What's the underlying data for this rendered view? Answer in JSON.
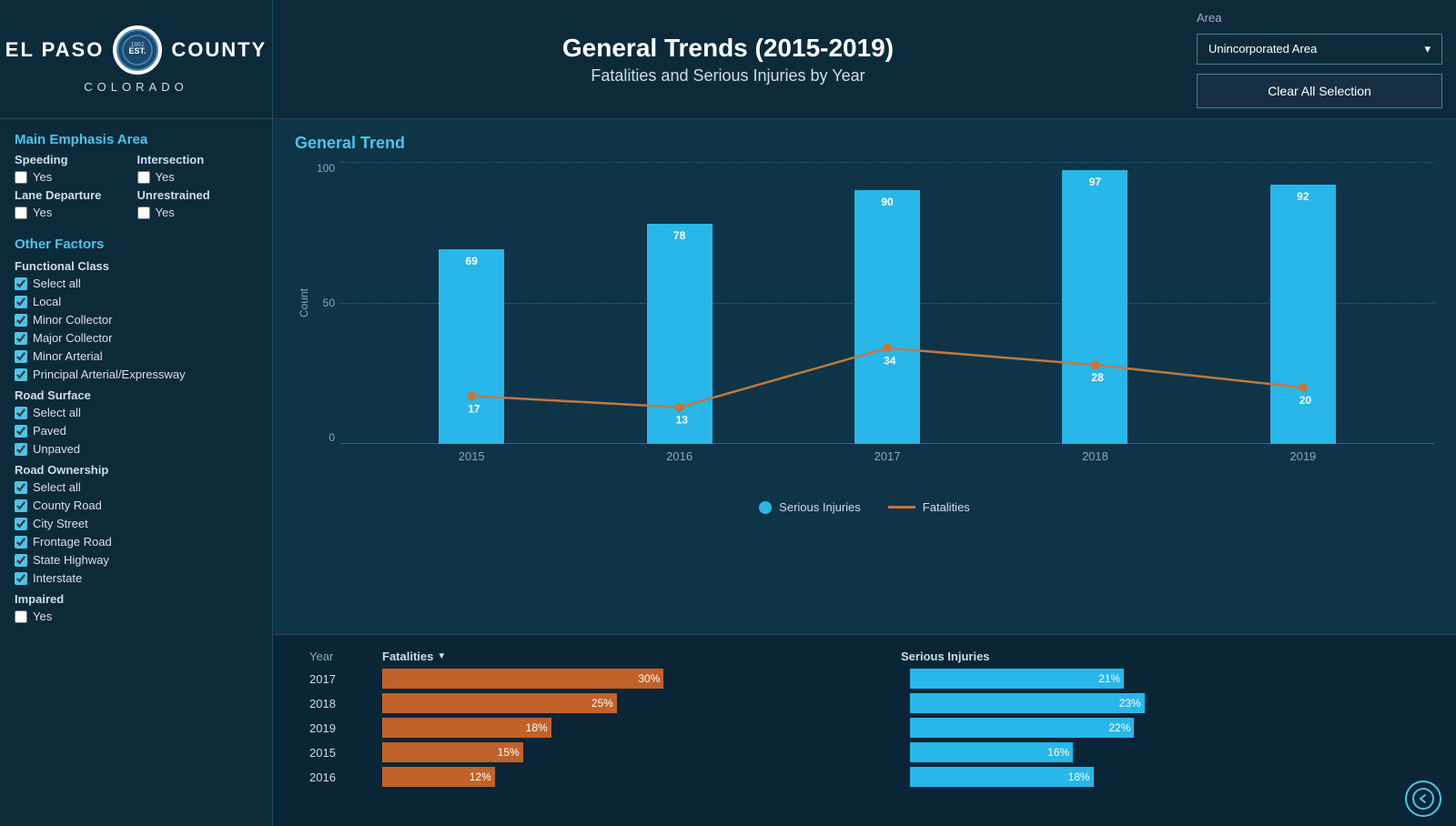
{
  "header": {
    "logo_text_1": "El Paso",
    "logo_text_2": "County",
    "logo_sub": "COLORADO",
    "title": "General Trends (2015-2019)",
    "subtitle": "Fatalities and Serious Injuries by Year",
    "area_label": "Area",
    "area_value": "Unincorporated Area",
    "clear_btn": "Clear All Selection"
  },
  "sidebar": {
    "main_emphasis_title": "Main Emphasis Area",
    "speeding_label": "Speeding",
    "speeding_yes": "Yes",
    "intersection_label": "Intersection",
    "intersection_yes": "Yes",
    "lane_departure_label": "Lane Departure",
    "lane_departure_yes": "Yes",
    "unrestrained_label": "Unrestrained",
    "unrestrained_yes": "Yes",
    "other_factors_title": "Other Factors",
    "functional_class_label": "Functional Class",
    "functional_class_items": [
      "Select all",
      "Local",
      "Minor Collector",
      "Major Collector",
      "Minor Arterial",
      "Principal Arterial/Expressway"
    ],
    "road_surface_label": "Road Surface",
    "road_surface_items": [
      "Select all",
      "Paved",
      "Unpaved"
    ],
    "road_ownership_label": "Road Ownership",
    "road_ownership_items": [
      "Select all",
      "County Road",
      "City Street",
      "Frontage Road",
      "State Highway",
      "Interstate"
    ],
    "impaired_label": "Impaired",
    "impaired_yes": "Yes"
  },
  "chart": {
    "title": "General Trend",
    "y_labels": [
      "100",
      "50",
      "0"
    ],
    "bars": [
      {
        "year": "2015",
        "value": 69,
        "fatalities": 17
      },
      {
        "year": "2016",
        "value": 78,
        "fatalities": 13
      },
      {
        "year": "2017",
        "value": 90,
        "fatalities": 34
      },
      {
        "year": "2018",
        "value": 97,
        "fatalities": 28
      },
      {
        "year": "2019",
        "value": 92,
        "fatalities": 20
      }
    ],
    "legend_serious": "Serious Injuries",
    "legend_fatalities": "Fatalities",
    "y_axis_label": "Count"
  },
  "table": {
    "col_year": "Year",
    "col_fatalities": "Fatalities",
    "col_serious": "Serious Injuries",
    "rows": [
      {
        "year": "2017",
        "fat_pct": 30,
        "fat_label": "30%",
        "si_pct": 21,
        "si_label": "21%"
      },
      {
        "year": "2018",
        "fat_pct": 25,
        "fat_label": "25%",
        "si_pct": 23,
        "si_label": "23%"
      },
      {
        "year": "2019",
        "fat_pct": 18,
        "fat_label": "18%",
        "si_pct": 22,
        "si_label": "22%"
      },
      {
        "year": "2015",
        "fat_pct": 15,
        "fat_label": "15%",
        "si_pct": 16,
        "si_label": "16%"
      },
      {
        "year": "2016",
        "fat_pct": 12,
        "fat_label": "12%",
        "si_pct": 18,
        "si_label": "18%"
      }
    ]
  }
}
